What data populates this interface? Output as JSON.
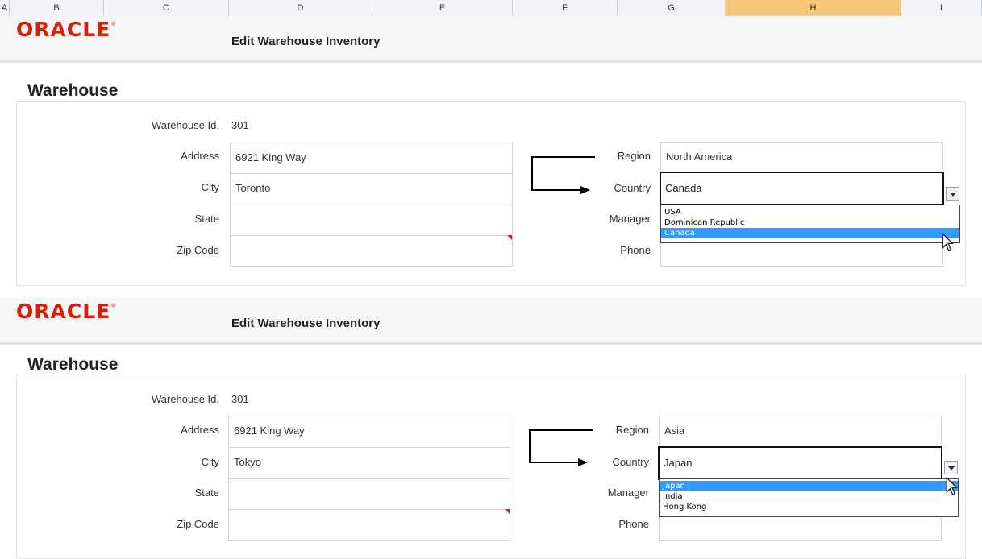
{
  "spreadsheet": {
    "columns": [
      "A",
      "B",
      "C",
      "D",
      "E",
      "F",
      "G",
      "H",
      "I"
    ]
  },
  "panels": [
    {
      "brand": "ORACLE",
      "title": "Edit Warehouse Inventory",
      "section": "Warehouse",
      "labels": {
        "warehouse_id": "Warehouse Id.",
        "address": "Address",
        "city": "City",
        "state": "State",
        "zip": "Zip Code",
        "region": "Region",
        "country": "Country",
        "manager": "Manager",
        "phone": "Phone"
      },
      "values": {
        "warehouse_id": "301",
        "address": "6921 King Way",
        "city": "Toronto",
        "state": "",
        "zip": "",
        "region": "North America",
        "country": "Canada",
        "manager": "",
        "phone": ""
      },
      "country_options": [
        {
          "label": "USA",
          "selected": false
        },
        {
          "label": "Dominican Republic",
          "selected": false
        },
        {
          "label": "Canada",
          "selected": true
        }
      ]
    },
    {
      "brand": "ORACLE",
      "title": "Edit Warehouse Inventory",
      "section": "Warehouse",
      "labels": {
        "warehouse_id": "Warehouse Id.",
        "address": "Address",
        "city": "City",
        "state": "State",
        "zip": "Zip Code",
        "region": "Region",
        "country": "Country",
        "manager": "Manager",
        "phone": "Phone"
      },
      "values": {
        "warehouse_id": "301",
        "address": "6921 King Way",
        "city": "Tokyo",
        "state": "",
        "zip": "",
        "region": "Asia",
        "country": "Japan",
        "manager": "",
        "phone": ""
      },
      "country_options": [
        {
          "label": "Japan",
          "selected": true
        },
        {
          "label": "India",
          "selected": false
        },
        {
          "label": "Hong Kong",
          "selected": false
        }
      ]
    }
  ],
  "colors": {
    "brand_red": "#d81e05",
    "selection_blue": "#3399ff",
    "selected_column": "#f8c87a"
  }
}
